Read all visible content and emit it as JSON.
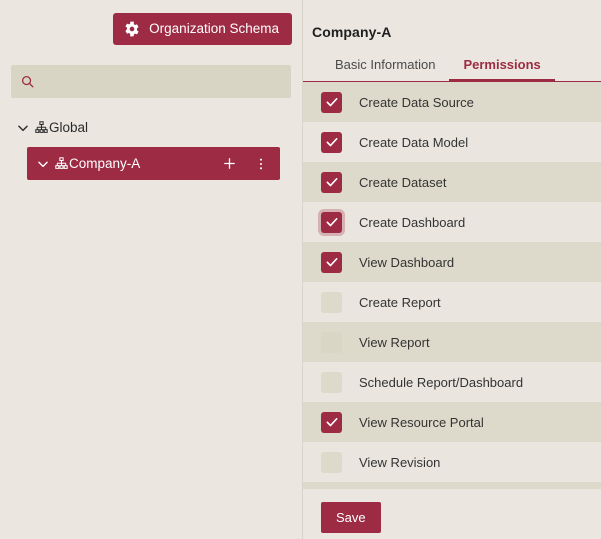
{
  "left": {
    "org_schema_button": {
      "label": "Organization Schema",
      "icon": "gear-icon"
    },
    "search": {
      "value": "",
      "placeholder": "",
      "icon": "search-icon"
    },
    "tree": [
      {
        "label": "Global",
        "icon": "hierarchy-icon",
        "chevron": "chevron-down-icon",
        "selected": false,
        "level": 0
      },
      {
        "label": "Company-A",
        "icon": "hierarchy-icon",
        "chevron": "chevron-down-icon",
        "selected": true,
        "level": 1,
        "actions": [
          "plus-icon",
          "more-vertical-icon"
        ]
      }
    ]
  },
  "right": {
    "title": "Company-A",
    "tabs": [
      {
        "label": "Basic Information",
        "active": false
      },
      {
        "label": "Permissions",
        "active": true
      }
    ],
    "permissions": [
      {
        "label": "Create Data Source",
        "checked": true,
        "focused": false
      },
      {
        "label": "Create Data Model",
        "checked": true,
        "focused": false
      },
      {
        "label": "Create Dataset",
        "checked": true,
        "focused": false
      },
      {
        "label": "Create Dashboard",
        "checked": true,
        "focused": true
      },
      {
        "label": "View Dashboard",
        "checked": true,
        "focused": false
      },
      {
        "label": "Create Report",
        "checked": false,
        "focused": false
      },
      {
        "label": "View Report",
        "checked": false,
        "focused": false
      },
      {
        "label": "Schedule Report/Dashboard",
        "checked": false,
        "focused": false
      },
      {
        "label": "View Resource Portal",
        "checked": true,
        "focused": false
      },
      {
        "label": "View Revision",
        "checked": false,
        "focused": false
      }
    ],
    "save_label": "Save"
  },
  "colors": {
    "accent": "#9c2b43",
    "panel_bg": "#ebe7e0",
    "row_odd": "#dedacb",
    "row_even": "#eae6df",
    "search_bg": "#d8d5c5"
  }
}
